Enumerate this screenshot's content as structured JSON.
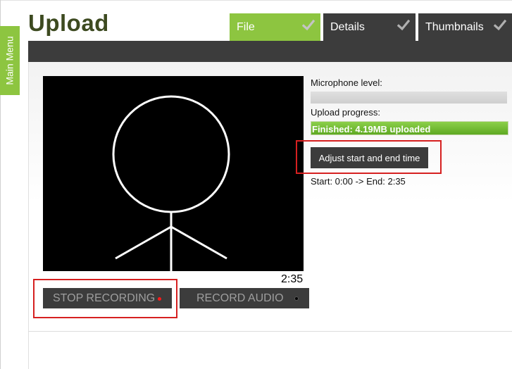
{
  "sidebar": {
    "main_menu_label": "Main Menu"
  },
  "page": {
    "title": "Upload"
  },
  "tabs": [
    {
      "label": "File",
      "active": true,
      "completed": true
    },
    {
      "label": "Details",
      "active": false,
      "completed": true
    },
    {
      "label": "Thumbnails",
      "active": false,
      "completed": true
    }
  ],
  "recorder": {
    "timer": "2:35",
    "stop_label": "STOP RECORDING",
    "record_audio_label": "RECORD AUDIO"
  },
  "status": {
    "mic_label": "Microphone level:",
    "mic_level_percent": 0,
    "upload_label": "Upload progress:",
    "upload_progress_percent": 100,
    "upload_text": "Finished: 4.19MB uploaded",
    "adjust_label": "Adjust start and end time",
    "time_range": "Start: 0:00 -> End: 2:35"
  },
  "colors": {
    "accent": "#8dc540",
    "dark": "#3c3c3c",
    "highlight": "#d62020",
    "recording_dot": "#ff1a1a"
  },
  "icons": {
    "tab_complete": "checkmark-icon",
    "stop_indicator": "red-dot-icon",
    "audio_indicator": "black-dot-icon",
    "video_content": "stick-figure-drawing"
  }
}
